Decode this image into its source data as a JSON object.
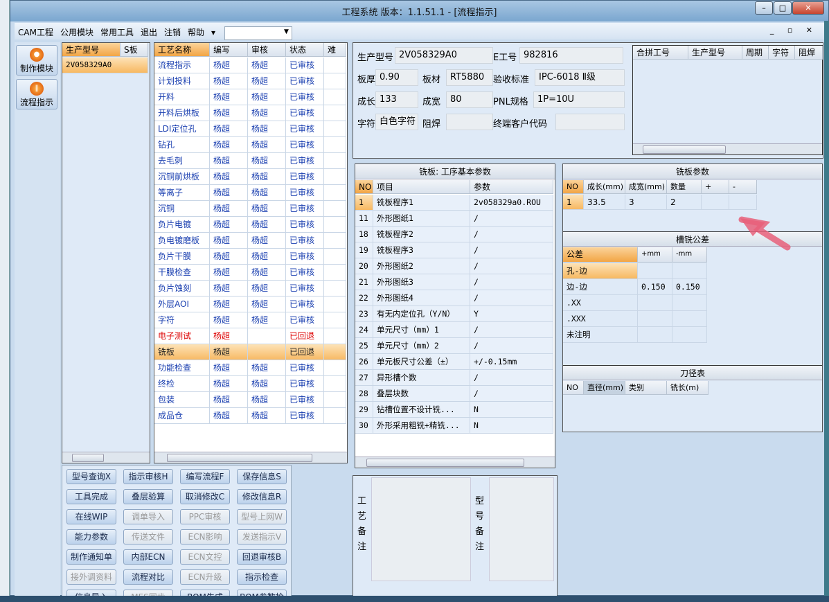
{
  "window": {
    "title": "工程系统  版本：1.1.51.1 - [流程指示]"
  },
  "menu": [
    "CAM工程",
    "公用模块",
    "常用工具",
    "退出",
    "注销",
    "帮助"
  ],
  "menu_combo_value": "",
  "side_buttons": [
    {
      "label": "制作模块",
      "icon": "fire-icon"
    },
    {
      "label": "流程指示",
      "icon": "pause-icon"
    }
  ],
  "model_list": {
    "headers": [
      "生产型号",
      "S板"
    ],
    "rows": [
      [
        "2V058329A0",
        ""
      ]
    ]
  },
  "process": {
    "headers": [
      "工艺名称",
      "编写",
      "审核",
      "状态",
      "难"
    ],
    "rows": [
      [
        "流程指示",
        "杨超",
        "杨超",
        "已审核"
      ],
      [
        "计划投料",
        "杨超",
        "杨超",
        "已审核"
      ],
      [
        "开料",
        "杨超",
        "杨超",
        "已审核"
      ],
      [
        "开料后烘板",
        "杨超",
        "杨超",
        "已审核"
      ],
      [
        "LDI定位孔",
        "杨超",
        "杨超",
        "已审核"
      ],
      [
        "钻孔",
        "杨超",
        "杨超",
        "已审核"
      ],
      [
        "去毛刺",
        "杨超",
        "杨超",
        "已审核"
      ],
      [
        "沉铜前烘板",
        "杨超",
        "杨超",
        "已审核"
      ],
      [
        "等离子",
        "杨超",
        "杨超",
        "已审核"
      ],
      [
        "沉铜",
        "杨超",
        "杨超",
        "已审核"
      ],
      [
        "负片电镀",
        "杨超",
        "杨超",
        "已审核"
      ],
      [
        "负电镀磨板",
        "杨超",
        "杨超",
        "已审核"
      ],
      [
        "负片干膜",
        "杨超",
        "杨超",
        "已审核"
      ],
      [
        "干膜检查",
        "杨超",
        "杨超",
        "已审核"
      ],
      [
        "负片蚀刻",
        "杨超",
        "杨超",
        "已审核"
      ],
      [
        "外层AOI",
        "杨超",
        "杨超",
        "已审核"
      ],
      [
        "字符",
        "杨超",
        "杨超",
        "已审核"
      ],
      [
        "电子测试",
        "杨超",
        "",
        "已回退"
      ],
      [
        "铣板",
        "杨超",
        "",
        "已回退"
      ],
      [
        "功能检查",
        "杨超",
        "杨超",
        "已审核"
      ],
      [
        "终检",
        "杨超",
        "杨超",
        "已审核"
      ],
      [
        "包装",
        "杨超",
        "杨超",
        "已审核"
      ],
      [
        "成品仓",
        "杨超",
        "杨超",
        "已审核"
      ]
    ],
    "selected_index": 18,
    "rejected_color": "#dd0000"
  },
  "buttons": [
    {
      "label": "型号查询X",
      "enabled": true
    },
    {
      "label": "指示审核H",
      "enabled": true
    },
    {
      "label": "编写流程F",
      "enabled": true
    },
    {
      "label": "保存信息S",
      "enabled": true
    },
    {
      "label": "工具完成",
      "enabled": true
    },
    {
      "label": "叠层验算",
      "enabled": true
    },
    {
      "label": "取消修改C",
      "enabled": true
    },
    {
      "label": "修改信息R",
      "enabled": true
    },
    {
      "label": "在线WIP",
      "enabled": true
    },
    {
      "label": "调单导入",
      "enabled": false
    },
    {
      "label": "PPC审核",
      "enabled": false
    },
    {
      "label": "型号上网W",
      "enabled": false
    },
    {
      "label": "能力参数",
      "enabled": true
    },
    {
      "label": "传送文件",
      "enabled": false
    },
    {
      "label": "ECN影响",
      "enabled": false
    },
    {
      "label": "发送指示V",
      "enabled": false
    },
    {
      "label": "制作通知单",
      "enabled": true
    },
    {
      "label": "内部ECN",
      "enabled": true
    },
    {
      "label": "ECN文控",
      "enabled": false
    },
    {
      "label": "回退审核B",
      "enabled": true
    },
    {
      "label": "接外调资料",
      "enabled": false
    },
    {
      "label": "流程对比",
      "enabled": true
    },
    {
      "label": "ECN升级",
      "enabled": false
    },
    {
      "label": "指示检查",
      "enabled": true
    },
    {
      "label": "信息导入",
      "enabled": true
    },
    {
      "label": "MES同步",
      "enabled": false
    },
    {
      "label": "BOM生成",
      "enabled": true
    },
    {
      "label": "BOM参数检查",
      "enabled": true
    }
  ],
  "info": {
    "fields": [
      {
        "label": "生产型号",
        "value": "2V058329A0"
      },
      {
        "label": "E工号",
        "value": "982816"
      },
      {
        "label": "板厚",
        "value": "0.90"
      },
      {
        "label": "板材",
        "value": "RT5880"
      },
      {
        "label": "验收标准",
        "value": "IPC-6018 Ⅱ级"
      },
      {
        "label": "成长",
        "value": "133"
      },
      {
        "label": "成宽",
        "value": "80"
      },
      {
        "label": "PNL规格",
        "value": "1P=10U"
      },
      {
        "label": "字符",
        "value": "白色字符"
      },
      {
        "label": "阻焊",
        "value": ""
      },
      {
        "label": "终端客户代码",
        "value": ""
      }
    ]
  },
  "merge_table": {
    "headers": [
      "合拼工号",
      "生产型号",
      "周期",
      "字符",
      "阻焊"
    ]
  },
  "routing_params": {
    "title": "铣板: 工序基本参数",
    "headers": [
      "NO",
      "项目",
      "参数"
    ],
    "rows": [
      [
        "1",
        "铣板程序1",
        "2v058329a0.ROU"
      ],
      [
        "11",
        "外形图纸1",
        "/"
      ],
      [
        "18",
        "铣板程序2",
        "/"
      ],
      [
        "19",
        "铣板程序3",
        "/"
      ],
      [
        "20",
        "外形图纸2",
        "/"
      ],
      [
        "21",
        "外形图纸3",
        "/"
      ],
      [
        "22",
        "外形图纸4",
        "/"
      ],
      [
        "23",
        "有无内定位孔（Y/N）",
        "Y"
      ],
      [
        "24",
        "单元尺寸（mm）1",
        "/"
      ],
      [
        "25",
        "单元尺寸（mm）2",
        "/"
      ],
      [
        "26",
        "单元板尺寸公差（±）",
        "+/-0.15mm"
      ],
      [
        "27",
        "异形槽个数",
        "/"
      ],
      [
        "28",
        "叠层块数",
        "/"
      ],
      [
        "29",
        "钻槽位置不设计铣...",
        "N"
      ],
      [
        "30",
        "外形采用粗铣+精铣...",
        "N"
      ]
    ]
  },
  "board_params": {
    "title": "铣板参数",
    "headers": [
      "NO",
      "成长(mm)",
      "成宽(mm)",
      "数量",
      "+",
      "-"
    ],
    "rows": [
      [
        "1",
        "33.5",
        "3",
        "2",
        "",
        ""
      ]
    ]
  },
  "slot_tolerance": {
    "title": "槽铣公差",
    "headers": [
      "公差",
      "+mm",
      "-mm"
    ],
    "rows": [
      [
        "孔-边",
        "",
        ""
      ],
      [
        "边-边",
        "0.150",
        "0.150"
      ],
      [
        ".XX",
        "",
        ""
      ],
      [
        ".XXX",
        "",
        ""
      ],
      [
        "未注明",
        "",
        ""
      ]
    ]
  },
  "tool_table": {
    "title": "刀径表",
    "headers": [
      "NO",
      "直径(mm)",
      "类别",
      "铣长(m)"
    ]
  },
  "remarks": {
    "process_label": "工艺备注",
    "model_label": "型号备注",
    "process_value": "",
    "model_value": ""
  },
  "annotation_arrow_color": "#e8607a"
}
